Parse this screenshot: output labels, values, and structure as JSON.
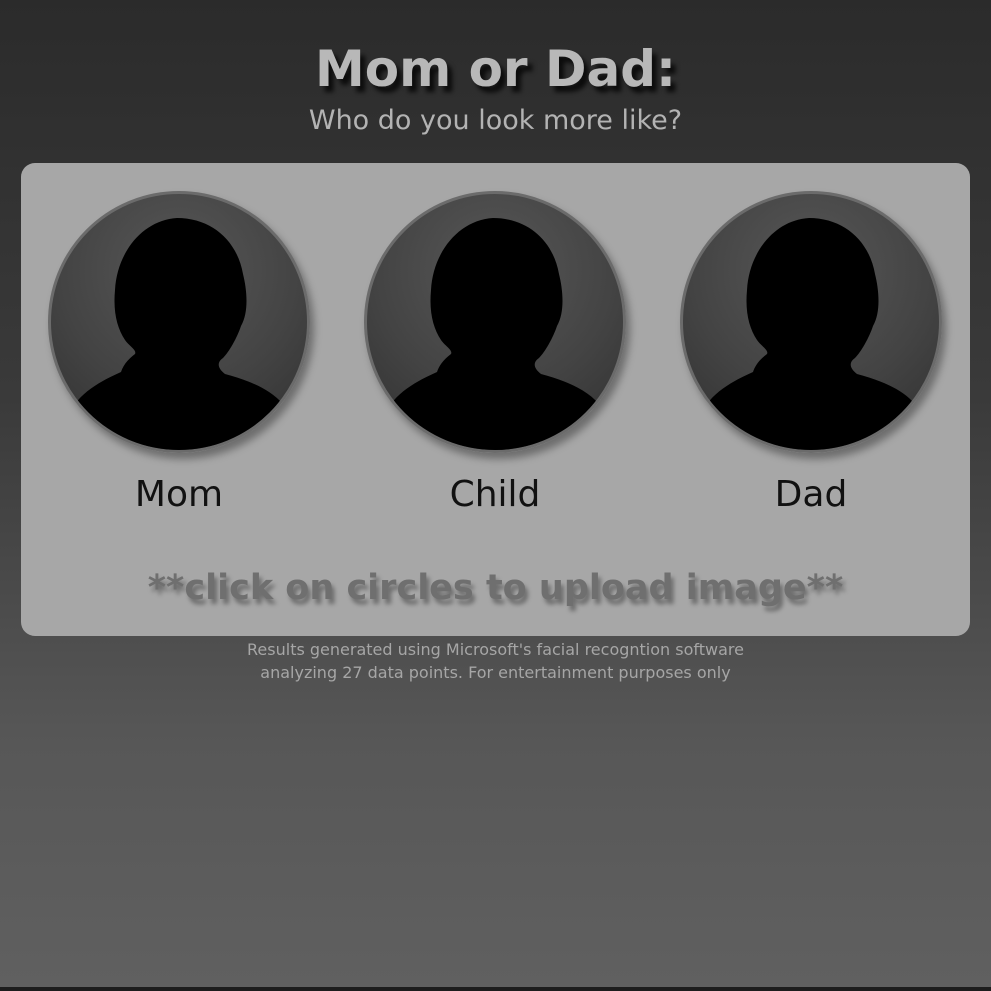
{
  "header": {
    "title": "Mom or Dad:",
    "subtitle": "Who do you look more like?"
  },
  "upload_slots": [
    {
      "label": "Mom",
      "icon": "person-silhouette-icon"
    },
    {
      "label": "Child",
      "icon": "person-silhouette-icon"
    },
    {
      "label": "Dad",
      "icon": "person-silhouette-icon"
    }
  ],
  "instruction": "**click on circles to upload image**",
  "disclaimer": {
    "line1": "Results generated using Microsoft's facial recogntion software",
    "line2": "analyzing 27 data points. For entertainment purposes only"
  },
  "colors": {
    "panel_background": "#a7a7a7",
    "title": "#b8b8b8",
    "silhouette": "#000000"
  }
}
